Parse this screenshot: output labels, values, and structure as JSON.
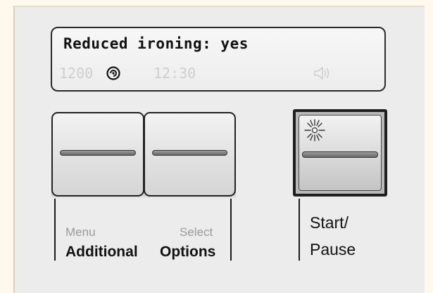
{
  "display": {
    "message": "Reduced ironing: yes",
    "spin_speed": "1200",
    "time": "12:30",
    "icons": [
      "spin-icon",
      "speaker-icon"
    ]
  },
  "buttons": {
    "menu": {
      "small_label": "Menu",
      "big_label": "Additional"
    },
    "select": {
      "small_label": "Select",
      "big_label": "Options"
    },
    "start": {
      "line1": "Start/",
      "line2": "Pause",
      "icon": "sun-icon"
    }
  },
  "colors": {
    "background": "#fff8ec",
    "panel": "#ececec",
    "display_text": "#111111",
    "inactive_text": "#cfcfcf"
  }
}
